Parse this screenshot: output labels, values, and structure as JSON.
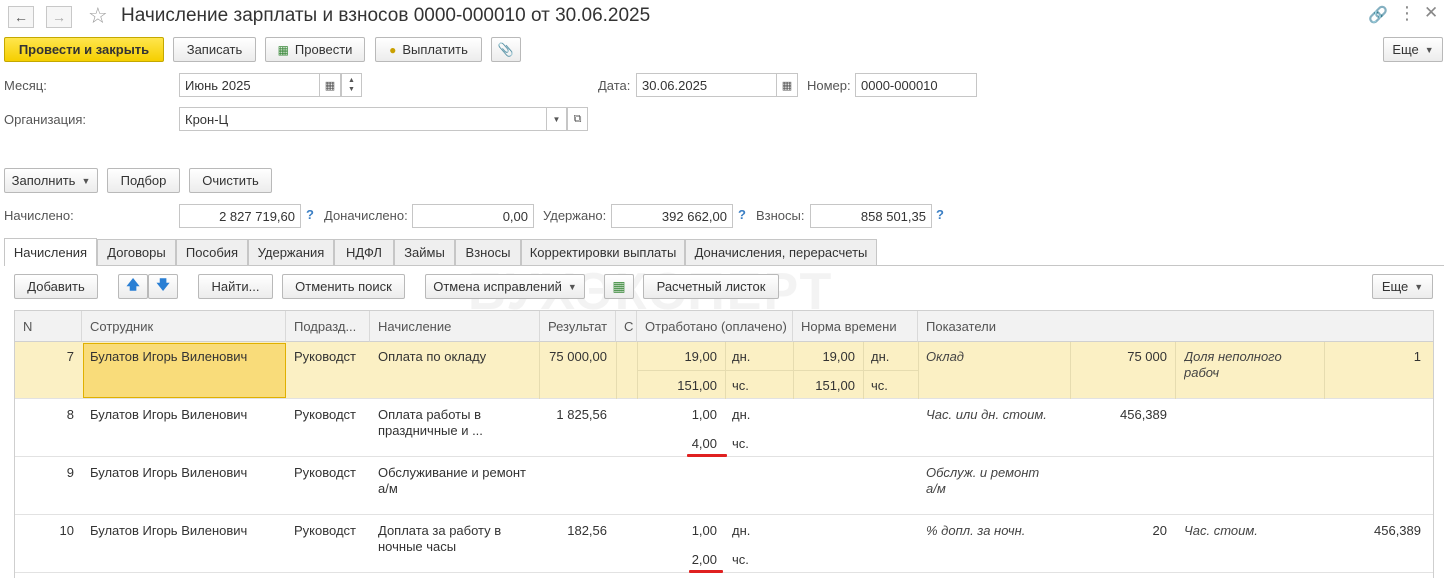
{
  "window": {
    "title": "Начисление зарплаты и взносов 0000-000010 от 30.06.2025"
  },
  "toolbar": {
    "post_close": "Провести и закрыть",
    "save": "Записать",
    "post": "Провести",
    "pay": "Выплатить",
    "more": "Еще"
  },
  "form": {
    "month_label": "Месяц:",
    "month_value": "Июнь 2025",
    "date_label": "Дата:",
    "date_value": "30.06.2025",
    "number_label": "Номер:",
    "number_value": "0000-000010",
    "org_label": "Организация:",
    "org_value": "Крон-Ц"
  },
  "actions": {
    "fill": "Заполнить",
    "pick": "Подбор",
    "clear": "Очистить"
  },
  "totals": {
    "accrued_label": "Начислено:",
    "accrued_value": "2 827 719,60",
    "additional_label": "Доначислено:",
    "additional_value": "0,00",
    "withheld_label": "Удержано:",
    "withheld_value": "392 662,00",
    "contributions_label": "Взносы:",
    "contributions_value": "858 501,35",
    "help": "?"
  },
  "tabs": [
    {
      "label": "Начисления"
    },
    {
      "label": "Договоры"
    },
    {
      "label": "Пособия"
    },
    {
      "label": "Удержания"
    },
    {
      "label": "НДФЛ"
    },
    {
      "label": "Займы"
    },
    {
      "label": "Взносы"
    },
    {
      "label": "Корректировки выплаты"
    },
    {
      "label": "Доначисления, перерасчеты"
    }
  ],
  "table_toolbar": {
    "add": "Добавить",
    "find": "Найти...",
    "cancel_search": "Отменить поиск",
    "cancel_corrections": "Отмена исправлений",
    "payslip": "Расчетный листок",
    "more": "Еще"
  },
  "watermark": "БУХЭКСПЕРТ",
  "table": {
    "columns": {
      "n": "N",
      "employee": "Сотрудник",
      "department": "Подразд...",
      "accrual": "Начисление",
      "result": "Результат",
      "extra": "С",
      "worked": "Отработано (оплачено)",
      "norm": "Норма времени",
      "indicators": "Показатели"
    },
    "rows": [
      {
        "n": "7",
        "employee": "Булатов Игорь Виленович",
        "department": "Руководст",
        "accrual": "Оплата по окладу",
        "accrual2": "",
        "result": "75 000,00",
        "worked1": "19,00",
        "worked1_unit": "дн.",
        "worked2": "151,00",
        "worked2_unit": "чс.",
        "norm1": "19,00",
        "norm1_unit": "дн.",
        "norm2": "151,00",
        "norm2_unit": "чс.",
        "ind1_name": "Оклад",
        "ind1_name2": "",
        "ind1_value": "75 000",
        "ind2_name": "Доля неполного",
        "ind2_name2": "рабоч",
        "ind2_value": "1"
      },
      {
        "n": "8",
        "employee": "Булатов Игорь Виленович",
        "department": "Руководст",
        "accrual": "Оплата работы в",
        "accrual2": "праздничные и ...",
        "result": "1 825,56",
        "worked1": "1,00",
        "worked1_unit": "дн.",
        "worked2": "4,00",
        "worked2_unit": "чс.",
        "norm1": "",
        "norm1_unit": "",
        "norm2": "",
        "norm2_unit": "",
        "ind1_name": "Час. или дн. стоим.",
        "ind1_name2": "",
        "ind1_value": "456,389",
        "ind2_name": "",
        "ind2_name2": "",
        "ind2_value": ""
      },
      {
        "n": "9",
        "employee": "Булатов Игорь Виленович",
        "department": "Руководст",
        "accrual": "Обслуживание и ремонт",
        "accrual2": "а/м",
        "result": "",
        "worked1": "",
        "worked1_unit": "",
        "worked2": "",
        "worked2_unit": "",
        "norm1": "",
        "norm1_unit": "",
        "norm2": "",
        "norm2_unit": "",
        "ind1_name": "Обслуж. и ремонт",
        "ind1_name2": "а/м",
        "ind1_value": "",
        "ind2_name": "",
        "ind2_name2": "",
        "ind2_value": ""
      },
      {
        "n": "10",
        "employee": "Булатов Игорь Виленович",
        "department": "Руководст",
        "accrual": "Доплата за работу в",
        "accrual2": "ночные часы",
        "result": "182,56",
        "worked1": "1,00",
        "worked1_unit": "дн.",
        "worked2": "2,00",
        "worked2_unit": "чс.",
        "norm1": "",
        "norm1_unit": "",
        "norm2": "",
        "norm2_unit": "",
        "ind1_name": "% допл. за ночн.",
        "ind1_name2": "",
        "ind1_value": "20",
        "ind2_name": "Час. стоим.",
        "ind2_name2": "",
        "ind2_value": "456,389"
      }
    ]
  }
}
